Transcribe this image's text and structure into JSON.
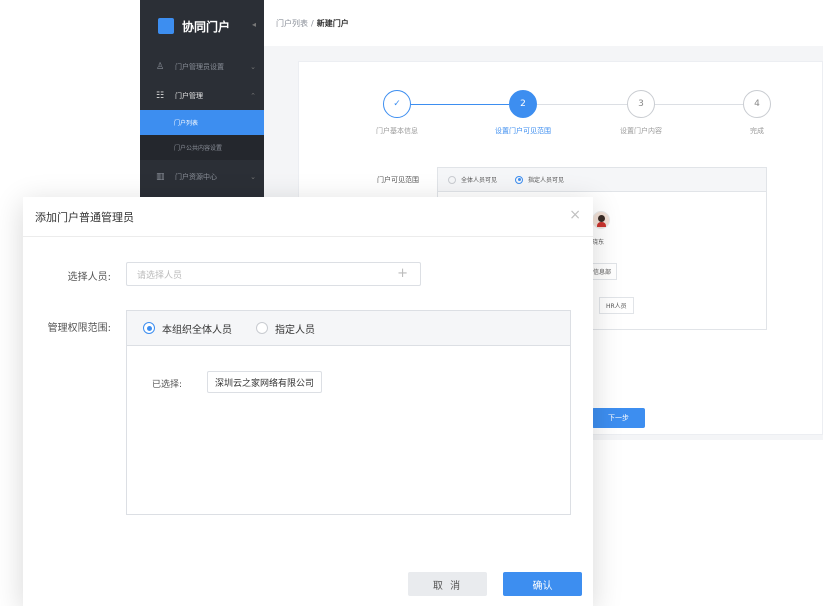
{
  "app": {
    "title": "协同门户",
    "nav": {
      "item1": "门户管理员设置",
      "group": "门户管理",
      "sub_active": "门户列表",
      "sub2": "门户公共内容设置",
      "item3": "门户资源中心"
    },
    "breadcrumb": {
      "link": "门户列表",
      "sep": "/",
      "current": "新建门户"
    },
    "steps": [
      {
        "num": "✓",
        "label": "门户基本信息"
      },
      {
        "num": "2",
        "label": "设置门户可见范围"
      },
      {
        "num": "3",
        "label": "设置门户内容"
      },
      {
        "num": "4",
        "label": "完成"
      }
    ],
    "visibility": {
      "label": "门户可见范围",
      "opt_all": "全体人员可见",
      "opt_specified": "指定人员可见",
      "avatar_name": "晓东",
      "dept_tag": "信息部",
      "hr_tag": "HR人员"
    },
    "next_button": "下一步"
  },
  "modal": {
    "title": "添加门户普通管理员",
    "close": "×",
    "select_label": "选择人员:",
    "select_placeholder": "请选择人员",
    "plus": "+",
    "range_label": "管理权限范围:",
    "opt_org": "本组织全体人员",
    "opt_specified": "指定人员",
    "selected_label": "已选择:",
    "selected_value": "深圳云之家网络有限公司",
    "cancel": "取 消",
    "ok": "确认"
  },
  "colors": {
    "accent": "#3d8ef0",
    "sidebar": "#2b2f36"
  }
}
